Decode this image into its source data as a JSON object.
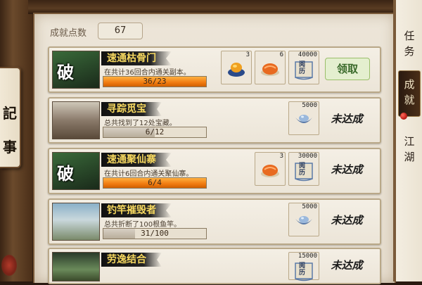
{
  "side_label_left": [
    "記",
    "事"
  ],
  "score": {
    "label": "成就点数",
    "value": "67"
  },
  "right_tabs": [
    {
      "chars": [
        "任",
        "务"
      ],
      "active": false
    },
    {
      "chars": [
        "成",
        "就"
      ],
      "active": true
    },
    {
      "chars": [
        "江",
        "湖"
      ],
      "active": false
    }
  ],
  "rows": [
    {
      "title": "速通枯骨门",
      "description": "在共计36回合内通关副本。",
      "badge": "破",
      "progress_text": "36/23",
      "progress_ratio": 1.0,
      "rewards": [
        {
          "type": "bowl-icon",
          "count": "3"
        },
        {
          "type": "bread-icon",
          "count": "6"
        },
        {
          "type": "exp-scroll-icon",
          "count": "40000",
          "label": "阅历"
        }
      ],
      "status": "领取"
    },
    {
      "title": "寻踪觅宝",
      "description": "总共找到了12处宝藏。",
      "badge": "",
      "progress_text": "6/12",
      "progress_ratio": 0.5,
      "rewards": [
        {
          "type": "silver-ingot-icon",
          "count": "5000"
        }
      ],
      "status": "未达成"
    },
    {
      "title": "速通聚仙寨",
      "description": "在共计6回合内通关聚仙寨。",
      "badge": "破",
      "progress_text": "6/4",
      "progress_ratio": 1.0,
      "rewards": [
        {
          "type": "bread-icon",
          "count": "3"
        },
        {
          "type": "exp-scroll-icon",
          "count": "30000",
          "label": "阅历"
        }
      ],
      "status": "未达成"
    },
    {
      "title": "钓竿摧毁者",
      "description": "总共折断了100根鱼竿。",
      "badge": "",
      "progress_text": "31/100",
      "progress_ratio": 0.31,
      "rewards": [
        {
          "type": "silver-ingot-icon",
          "count": "5000"
        }
      ],
      "status": "未达成"
    },
    {
      "title": "劳逸结合",
      "description": "",
      "badge": "",
      "progress_text": "",
      "progress_ratio": 0,
      "rewards": [
        {
          "type": "exp-scroll-icon",
          "count": "15000",
          "label": "阅历"
        }
      ],
      "status": "未达成"
    }
  ]
}
